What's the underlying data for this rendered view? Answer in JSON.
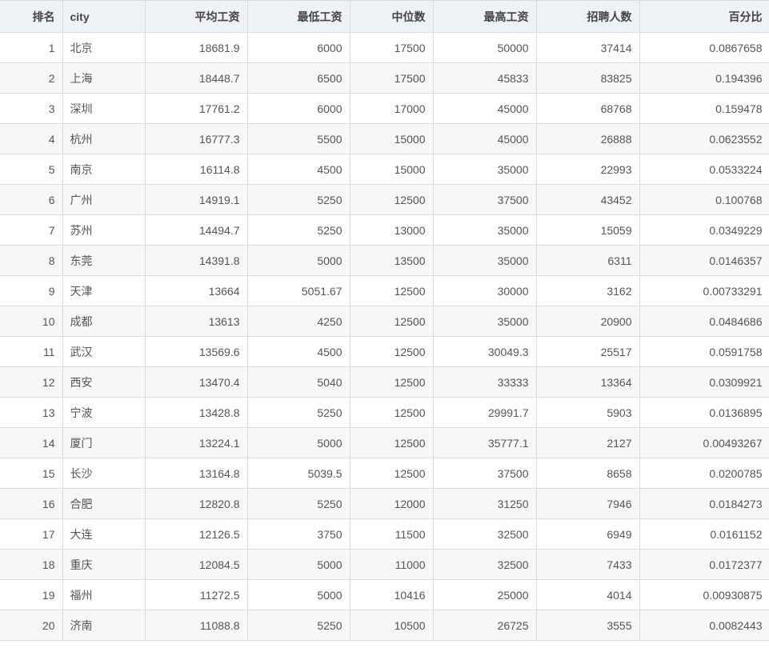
{
  "table": {
    "columns": [
      "排名",
      "city",
      "平均工资",
      "最低工资",
      "中位数",
      "最高工资",
      "招聘人数",
      "百分比"
    ],
    "rows": [
      [
        "1",
        "北京",
        "18681.9",
        "6000",
        "17500",
        "50000",
        "37414",
        "0.0867658"
      ],
      [
        "2",
        "上海",
        "18448.7",
        "6500",
        "17500",
        "45833",
        "83825",
        "0.194396"
      ],
      [
        "3",
        "深圳",
        "17761.2",
        "6000",
        "17000",
        "45000",
        "68768",
        "0.159478"
      ],
      [
        "4",
        "杭州",
        "16777.3",
        "5500",
        "15000",
        "45000",
        "26888",
        "0.0623552"
      ],
      [
        "5",
        "南京",
        "16114.8",
        "4500",
        "15000",
        "35000",
        "22993",
        "0.0533224"
      ],
      [
        "6",
        "广州",
        "14919.1",
        "5250",
        "12500",
        "37500",
        "43452",
        "0.100768"
      ],
      [
        "7",
        "苏州",
        "14494.7",
        "5250",
        "13000",
        "35000",
        "15059",
        "0.0349229"
      ],
      [
        "8",
        "东莞",
        "14391.8",
        "5000",
        "13500",
        "35000",
        "6311",
        "0.0146357"
      ],
      [
        "9",
        "天津",
        "13664",
        "5051.67",
        "12500",
        "30000",
        "3162",
        "0.00733291"
      ],
      [
        "10",
        "成都",
        "13613",
        "4250",
        "12500",
        "35000",
        "20900",
        "0.0484686"
      ],
      [
        "11",
        "武汉",
        "13569.6",
        "4500",
        "12500",
        "30049.3",
        "25517",
        "0.0591758"
      ],
      [
        "12",
        "西安",
        "13470.4",
        "5040",
        "12500",
        "33333",
        "13364",
        "0.0309921"
      ],
      [
        "13",
        "宁波",
        "13428.8",
        "5250",
        "12500",
        "29991.7",
        "5903",
        "0.0136895"
      ],
      [
        "14",
        "厦门",
        "13224.1",
        "5000",
        "12500",
        "35777.1",
        "2127",
        "0.00493267"
      ],
      [
        "15",
        "长沙",
        "13164.8",
        "5039.5",
        "12500",
        "37500",
        "8658",
        "0.0200785"
      ],
      [
        "16",
        "合肥",
        "12820.8",
        "5250",
        "12000",
        "31250",
        "7946",
        "0.0184273"
      ],
      [
        "17",
        "大连",
        "12126.5",
        "3750",
        "11500",
        "32500",
        "6949",
        "0.0161152"
      ],
      [
        "18",
        "重庆",
        "12084.5",
        "5000",
        "11000",
        "32500",
        "7433",
        "0.0172377"
      ],
      [
        "19",
        "福州",
        "11272.5",
        "5000",
        "10416",
        "25000",
        "4014",
        "0.00930875"
      ],
      [
        "20",
        "济南",
        "11088.8",
        "5250",
        "10500",
        "26725",
        "3555",
        "0.0082443"
      ]
    ]
  }
}
